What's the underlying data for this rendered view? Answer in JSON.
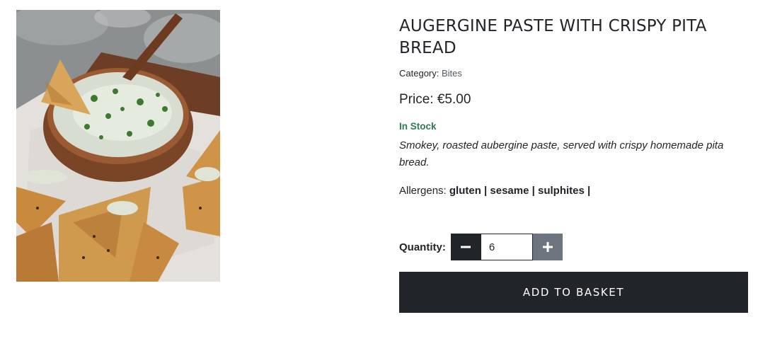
{
  "product": {
    "title": "AUGERGINE PASTE WITH CRISPY PITA BREAD",
    "category_label": "Category:",
    "category_value": "Bites",
    "price": "Price: €5.00",
    "stock": "In Stock",
    "description": "Smokey, roasted aubergine paste, served with crispy homemade pita bread.",
    "allergens_label": "Allergens:",
    "allergens_list": "gluten | sesame | sulphites |",
    "image_icon": "product-photo"
  },
  "quantity": {
    "label": "Quantity:",
    "value": "6",
    "minus_icon": "minus-icon",
    "plus_icon": "plus-icon"
  },
  "actions": {
    "add_to_basket": "ADD TO BASKET"
  },
  "colors": {
    "dark": "#212529",
    "secondary": "#6c757d",
    "stock_green": "#2f7a55"
  }
}
